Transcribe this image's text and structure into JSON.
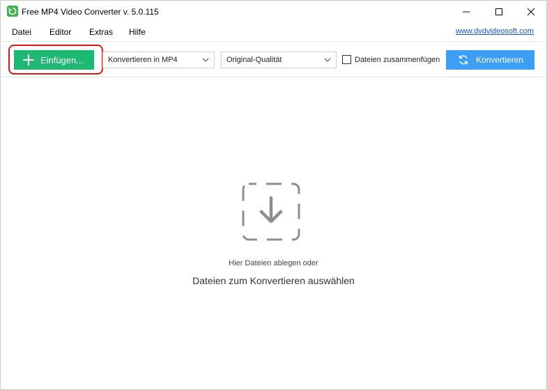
{
  "window": {
    "title": "Free MP4 Video Converter v. 5.0.115"
  },
  "menu": {
    "items": [
      {
        "label": "Datei"
      },
      {
        "label": "Editor"
      },
      {
        "label": "Extras"
      },
      {
        "label": "Hilfe"
      }
    ],
    "site_link": "www.dvdvideosoft.com"
  },
  "toolbar": {
    "add_label": "Einfügen...",
    "format_value": "Konvertieren in MP4",
    "quality_value": "Original-Qualität",
    "merge_label": "Dateien zusammenfügen",
    "merge_checked": false,
    "convert_label": "Konvertieren"
  },
  "dropzone": {
    "hint": "Hier Dateien ablegen oder",
    "main": "Dateien zum Konvertieren auswählen"
  },
  "colors": {
    "add_button": "#1fb872",
    "convert_button": "#3c9ff5",
    "highlight": "#e01515",
    "link": "#1a56c7"
  }
}
